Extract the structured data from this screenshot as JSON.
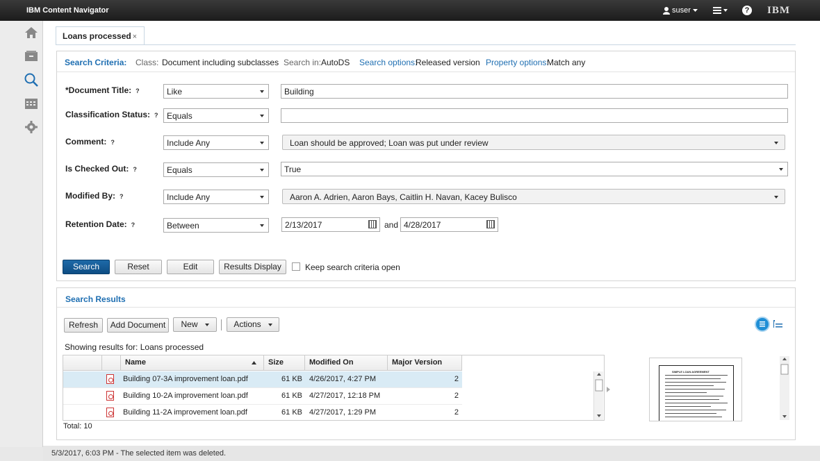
{
  "app": {
    "title": "IBM Content Navigator",
    "user": "suser",
    "help": "?",
    "brand": "IBM"
  },
  "sidebar": {
    "items": [
      {
        "icon": "home-icon"
      },
      {
        "icon": "cabinet-icon"
      },
      {
        "icon": "search-icon"
      },
      {
        "icon": "calendar-icon"
      },
      {
        "icon": "gear-icon"
      }
    ]
  },
  "tab": {
    "label": "Loans processed",
    "close": "×"
  },
  "criteria": {
    "header": "Search Criteria:",
    "class_label": "Class:",
    "class_value": "Document including subclasses",
    "search_in_label": "Search in:",
    "search_in_value": "AutoDS",
    "search_options_label": "Search options:",
    "search_options_value": "Released version",
    "property_options_label": "Property options:",
    "property_options_value": "Match any",
    "help": "?",
    "rows": [
      {
        "label": "*Document Title:",
        "operator": "Like",
        "value": "Building"
      },
      {
        "label": "Classification Status:",
        "operator": "Equals",
        "value": ""
      },
      {
        "label": "Comment:",
        "operator": "Include Any",
        "value": "Loan should be approved; Loan was put under review"
      },
      {
        "label": "Is Checked Out:",
        "operator": "Equals",
        "value": "True"
      },
      {
        "label": "Modified By:",
        "operator": "Include Any",
        "value": "Aaron A. Adrien, Aaron Bays, Caitlin H. Navan, Kacey Bulisco"
      },
      {
        "label": "Retention Date:",
        "operator": "Between",
        "value": "2/13/2017",
        "value2": "4/28/2017",
        "and": "and"
      }
    ],
    "buttons": {
      "search": "Search",
      "reset": "Reset",
      "edit": "Edit",
      "results_display": "Results Display"
    },
    "keep_open": "Keep search criteria open"
  },
  "results": {
    "header": "Search Results",
    "toolbar": {
      "refresh": "Refresh",
      "add_document": "Add Document",
      "new": "New",
      "actions": "Actions"
    },
    "showing": "Showing results for: Loans processed",
    "columns": [
      "Name",
      "Size",
      "Modified On",
      "Major Version"
    ],
    "rows": [
      {
        "name": "Building 07-3A improvement loan.pdf",
        "size": "61 KB",
        "modified": "4/26/2017, 4:27 PM",
        "version": "2"
      },
      {
        "name": "Building 10-2A improvement loan.pdf",
        "size": "61 KB",
        "modified": "4/27/2017, 12:18 PM",
        "version": "2"
      },
      {
        "name": "Building 11-2A improvement loan.pdf",
        "size": "61 KB",
        "modified": "4/27/2017, 1:29 PM",
        "version": "2"
      }
    ],
    "total": "Total: 10",
    "preview_title": "SIMPLE LOAN AGREEMENT"
  },
  "status": {
    "message": "5/3/2017, 6:03 PM - The selected item was deleted."
  },
  "colors": {
    "accent": "#1f6fb2",
    "primary_button": "#0e4d84",
    "selected_row": "#d9ebf5",
    "topbar": "#1c1c1c"
  }
}
